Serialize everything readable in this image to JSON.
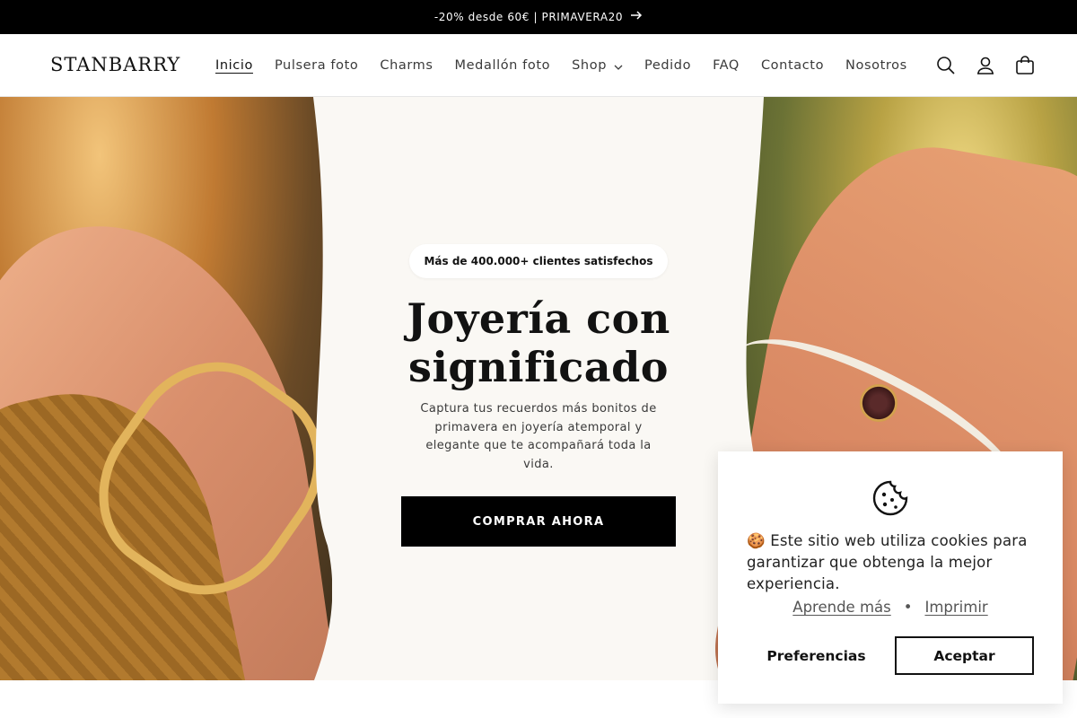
{
  "announcement": {
    "text": "-20% desde 60€ | PRIMAVERA20",
    "arrow_icon": "arrow-right-icon"
  },
  "header": {
    "logo": "STANBARRY",
    "nav": [
      {
        "label": "Inicio",
        "active": true
      },
      {
        "label": "Pulsera foto"
      },
      {
        "label": "Charms"
      },
      {
        "label": "Medallón foto"
      },
      {
        "label": "Shop",
        "has_dropdown": true
      },
      {
        "label": "Pedido"
      },
      {
        "label": "FAQ"
      },
      {
        "label": "Contacto"
      },
      {
        "label": "Nosotros"
      }
    ],
    "icons": [
      "search-icon",
      "account-icon",
      "cart-icon"
    ]
  },
  "hero": {
    "badge": "Más de 400.000+ clientes satisfechos",
    "title": "Joyería con significado",
    "subtitle": "Captura tus recuerdos más bonitos de primavera en joyería atemporal y elegante que te acompañará toda la vida.",
    "cta": "COMPRAR AHORA"
  },
  "cookie_banner": {
    "icon": "cookie-icon",
    "text": "🍪 Este sitio web utiliza cookies para garantizar que obtenga la mejor experiencia.",
    "learn_more": "Aprende más",
    "separator": "•",
    "print": "Imprimir",
    "preferences_button": "Preferencias",
    "accept_button": "Aceptar"
  },
  "colors": {
    "announcement_bg": "#000000",
    "cta_bg": "#000000",
    "hero_center_bg": "#faf8f4"
  }
}
